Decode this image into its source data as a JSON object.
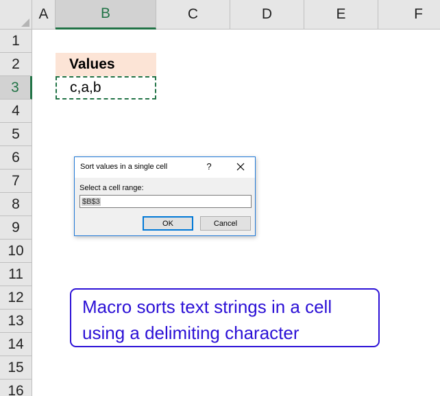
{
  "spreadsheet": {
    "columns": [
      "A",
      "B",
      "C",
      "D",
      "E",
      "F"
    ],
    "selected_column": "B",
    "rows": [
      "1",
      "2",
      "3",
      "4",
      "5",
      "6",
      "7",
      "8",
      "9",
      "10",
      "11",
      "12",
      "13",
      "14",
      "15",
      "16"
    ],
    "selected_row": "3",
    "cells": {
      "B2": "Values",
      "B3": "c,a,b"
    },
    "colors": {
      "header_fill": "#fce4d6",
      "selection_accent": "#217346"
    }
  },
  "dialog": {
    "title": "Sort values in a single cell",
    "help_glyph": "?",
    "close_icon": "close-icon",
    "label": "Select a cell range:",
    "input_value": "$B$3",
    "ok_label": "OK",
    "cancel_label": "Cancel"
  },
  "annotation": {
    "line1": "Macro sorts text strings in a cell",
    "line2": "using a delimiting character",
    "color": "#2b10d6"
  }
}
